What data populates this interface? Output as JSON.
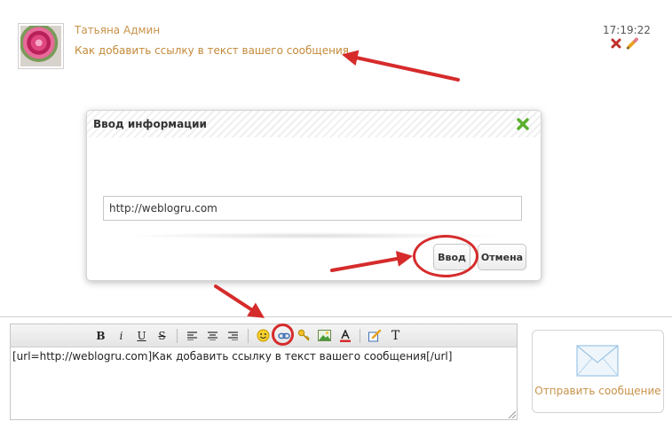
{
  "message": {
    "author": "Татьяна Админ",
    "text": "Как добавить ссылку в текст вашего сообщения",
    "time": "17:19:22",
    "actions": [
      "delete-icon",
      "edit-icon"
    ]
  },
  "dialog": {
    "title": "Ввод информации",
    "url_value": "http://weblogru.com",
    "ok_label": "Ввод",
    "cancel_label": "Отмена"
  },
  "toolbar": {
    "bold": "B",
    "italic": "i",
    "underline": "U",
    "strike": "S",
    "text_tool": "T",
    "buttons": [
      "bold",
      "italic",
      "underline",
      "strikethrough",
      "align-left",
      "align-center",
      "align-right",
      "smiley",
      "link",
      "key",
      "image",
      "text-color",
      "edit",
      "text"
    ]
  },
  "editor": {
    "content": "[url=http://weblogru.com]Как добавить ссылку в текст вашего сообщения[/url]"
  },
  "send": {
    "label": "Отправить сообщение"
  },
  "colors": {
    "accent": "#c9924a",
    "annotation_red": "#d62b2b",
    "close_green": "#5cb030"
  }
}
